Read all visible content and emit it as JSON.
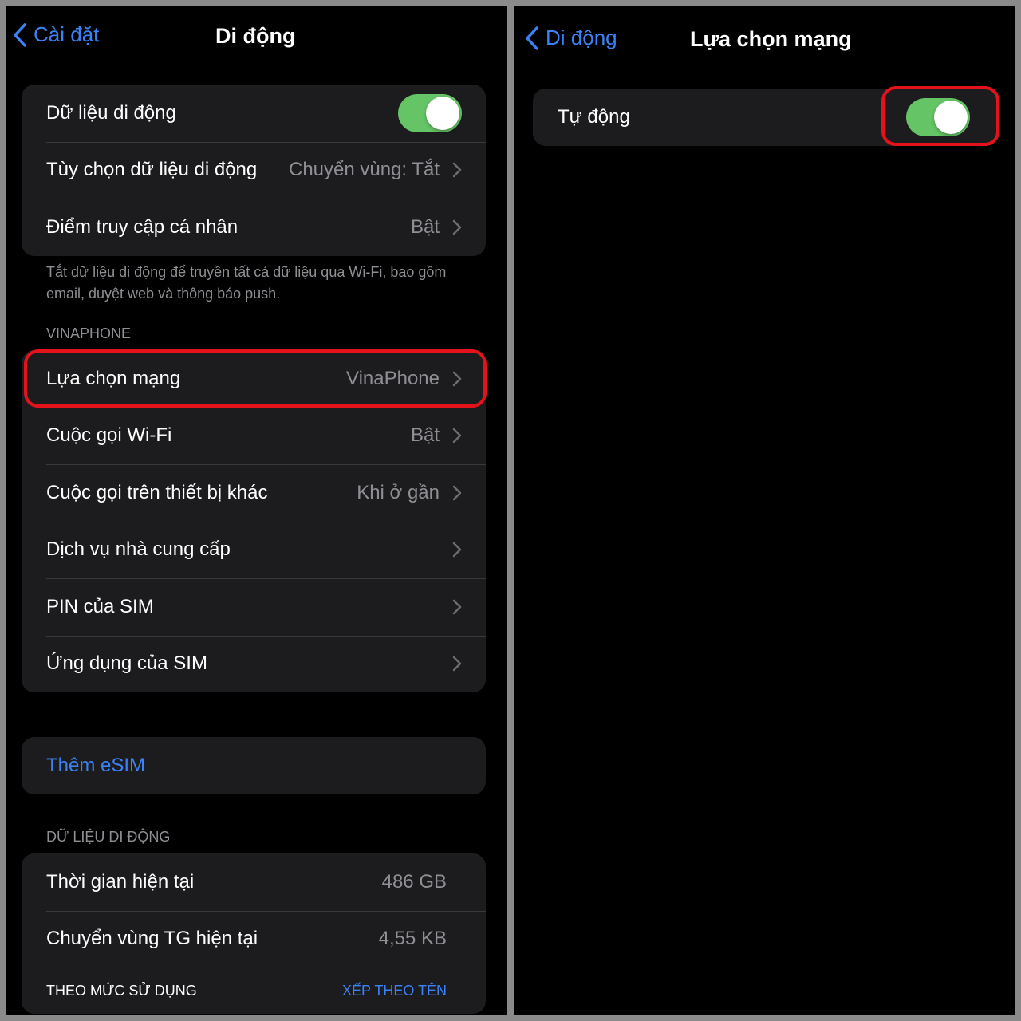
{
  "left": {
    "back_label": "Cài đặt",
    "title": "Di động",
    "group1": [
      {
        "label": "Dữ liệu di động",
        "toggle": true
      },
      {
        "label": "Tùy chọn dữ liệu di động",
        "value": "Chuyển vùng: Tắt"
      },
      {
        "label": "Điểm truy cập cá nhân",
        "value": "Bật"
      }
    ],
    "group1_footer": "Tắt dữ liệu di động để truyền tất cả dữ liệu qua Wi-Fi, bao gồm email, duyệt web và thông báo push.",
    "carrier_header": "VINAPHONE",
    "group2": [
      {
        "label": "Lựa chọn mạng",
        "value": "VinaPhone"
      },
      {
        "label": "Cuộc gọi Wi-Fi",
        "value": "Bật"
      },
      {
        "label": "Cuộc gọi trên thiết bị khác",
        "value": "Khi ở gần"
      },
      {
        "label": "Dịch vụ nhà cung cấp",
        "value": ""
      },
      {
        "label": "PIN của SIM",
        "value": ""
      },
      {
        "label": "Ứng dụng của SIM",
        "value": ""
      }
    ],
    "add_esim": "Thêm eSIM",
    "data_header": "DỮ LIỆU DI ĐỘNG",
    "usage": [
      {
        "label": "Thời gian hiện tại",
        "value": "486 GB"
      },
      {
        "label": "Chuyển vùng TG hiện tại",
        "value": "4,55 KB"
      }
    ],
    "sort_label": "THEO MỨC SỬ DỤNG",
    "sort_action": "XẾP THEO TÊN"
  },
  "right": {
    "back_label": "Di động",
    "title": "Lựa chọn mạng",
    "automatic": {
      "label": "Tự động",
      "toggle": true
    }
  },
  "colors": {
    "accent": "#3b82f6",
    "toggle_on": "#65c466",
    "highlight": "#e4131b",
    "cell_bg": "#1c1c1e"
  }
}
